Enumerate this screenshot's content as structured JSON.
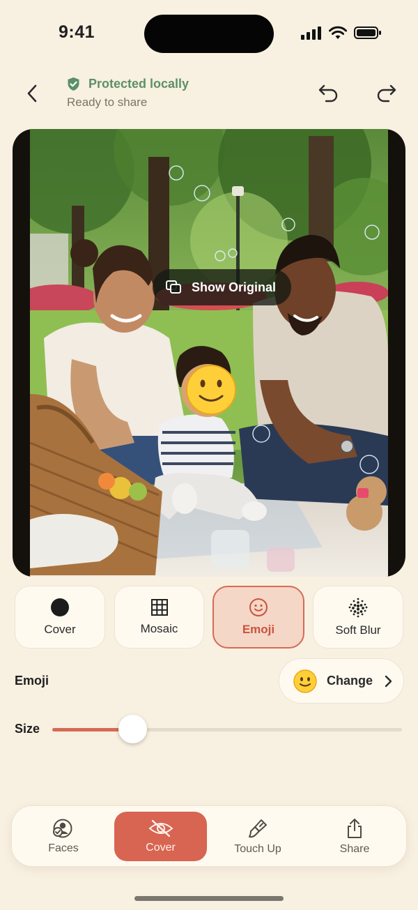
{
  "status_bar": {
    "time": "9:41"
  },
  "header": {
    "protected_label": "Protected locally",
    "ready_label": "Ready to share"
  },
  "photo": {
    "show_original_label": "Show Original"
  },
  "modes": [
    {
      "id": "cover",
      "label": "Cover",
      "icon": "filled-circle-icon",
      "active": false
    },
    {
      "id": "mosaic",
      "label": "Mosaic",
      "icon": "grid-icon",
      "active": false
    },
    {
      "id": "emoji",
      "label": "Emoji",
      "icon": "smiley-face-icon",
      "active": true
    },
    {
      "id": "soft-blur",
      "label": "Soft Blur",
      "icon": "dotted-blur-icon",
      "active": false
    }
  ],
  "emoji_setting": {
    "label": "Emoji",
    "selected_emoji": "🙂",
    "change_label": "Change"
  },
  "size_setting": {
    "label": "Size",
    "value_fraction": 0.23
  },
  "tabs": [
    {
      "id": "faces",
      "label": "Faces",
      "icon": "face-check-icon",
      "active": false
    },
    {
      "id": "cover",
      "label": "Cover",
      "icon": "eye-slash-icon",
      "active": true
    },
    {
      "id": "touch-up",
      "label": "Touch Up",
      "icon": "brush-icon",
      "active": false
    },
    {
      "id": "share",
      "label": "Share",
      "icon": "share-icon",
      "active": false
    }
  ],
  "colors": {
    "background": "#f8f0e1",
    "accent": "#d66a57",
    "protected_green": "#5b9068",
    "active_tile_bg": "#f4d7c6"
  }
}
